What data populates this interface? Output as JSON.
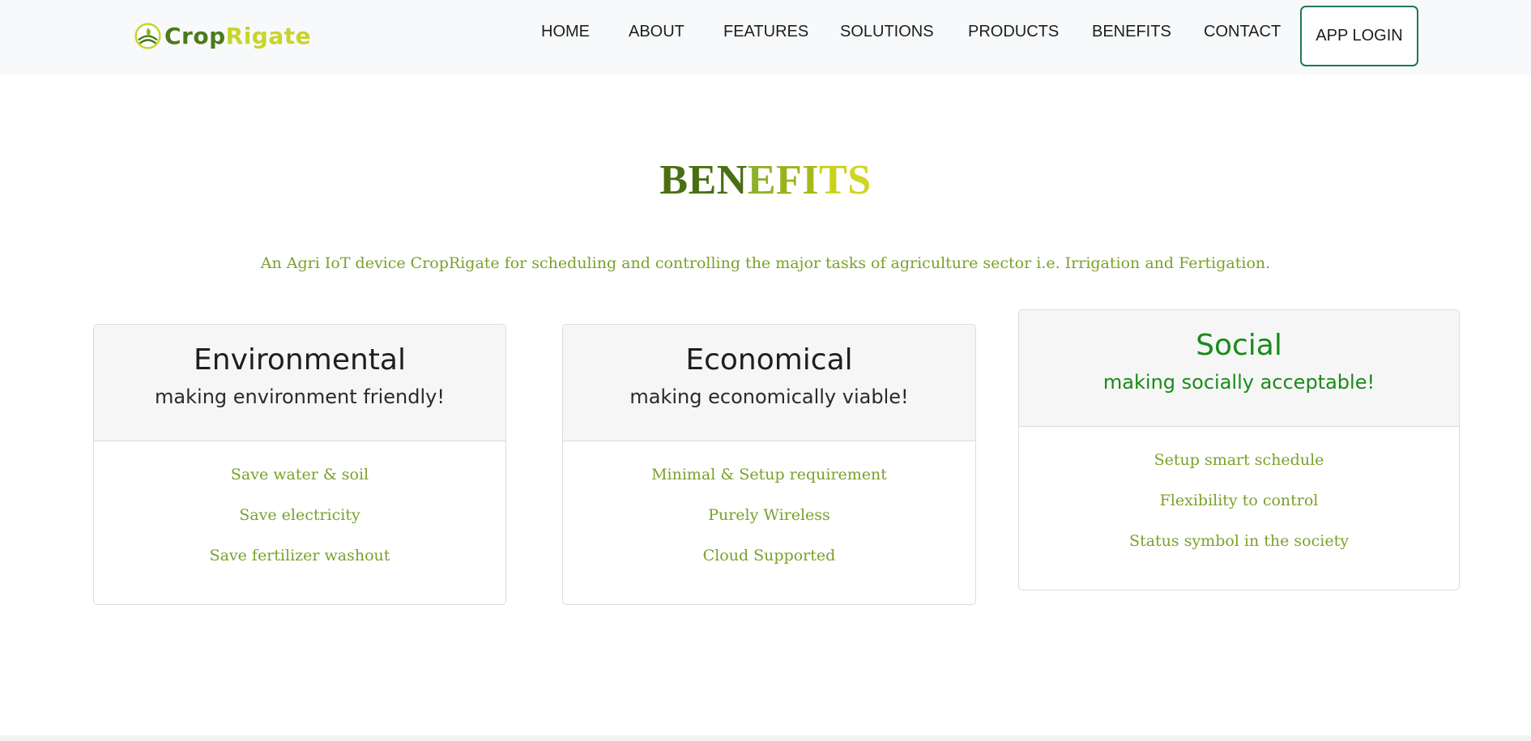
{
  "brand": {
    "name_part1": "Crop",
    "name_part2": "Rigate",
    "logo_icon": "leaf-field-icon"
  },
  "nav": {
    "items": [
      {
        "label": "HOME"
      },
      {
        "label": "ABOUT"
      },
      {
        "label": "FEATURES"
      },
      {
        "label": "SOLUTIONS"
      },
      {
        "label": "PRODUCTS"
      },
      {
        "label": "BENEFITS"
      },
      {
        "label": "CONTACT"
      }
    ],
    "app_login_label": "APP LOGIN"
  },
  "section": {
    "title_letters": [
      {
        "char": "B",
        "color": "#4b6e12"
      },
      {
        "char": "E",
        "color": "#4b6e12"
      },
      {
        "char": "N",
        "color": "#4b6e12"
      },
      {
        "char": "E",
        "color": "#8fb12a"
      },
      {
        "char": "F",
        "color": "#99b31c"
      },
      {
        "char": "I",
        "color": "#a7b81a"
      },
      {
        "char": "T",
        "color": "#c8d21a"
      },
      {
        "char": "S",
        "color": "#cfd623"
      }
    ],
    "subtitle": "An Agri IoT device CropRigate for scheduling and controlling the major tasks of agriculture sector i.e. Irrigation and Fertigation."
  },
  "cards": [
    {
      "title": "Environmental",
      "subtitle": "making environment friendly!",
      "items": [
        "Save water & soil",
        "Save electricity",
        "Save fertilizer washout"
      ]
    },
    {
      "title": "Economical",
      "subtitle": "making economically viable!",
      "items": [
        "Minimal & Setup requirement",
        "Purely Wireless",
        "Cloud Supported"
      ]
    },
    {
      "title": "Social",
      "subtitle": "making socially acceptable!",
      "items": [
        "Setup smart schedule",
        "Flexibility to control",
        "Status symbol in the society"
      ]
    }
  ],
  "colors": {
    "accent_green": "#1f7a52",
    "text_green": "#7aa12a",
    "social_green": "#1a8a1a",
    "nav_bg": "#f8f9fa"
  }
}
